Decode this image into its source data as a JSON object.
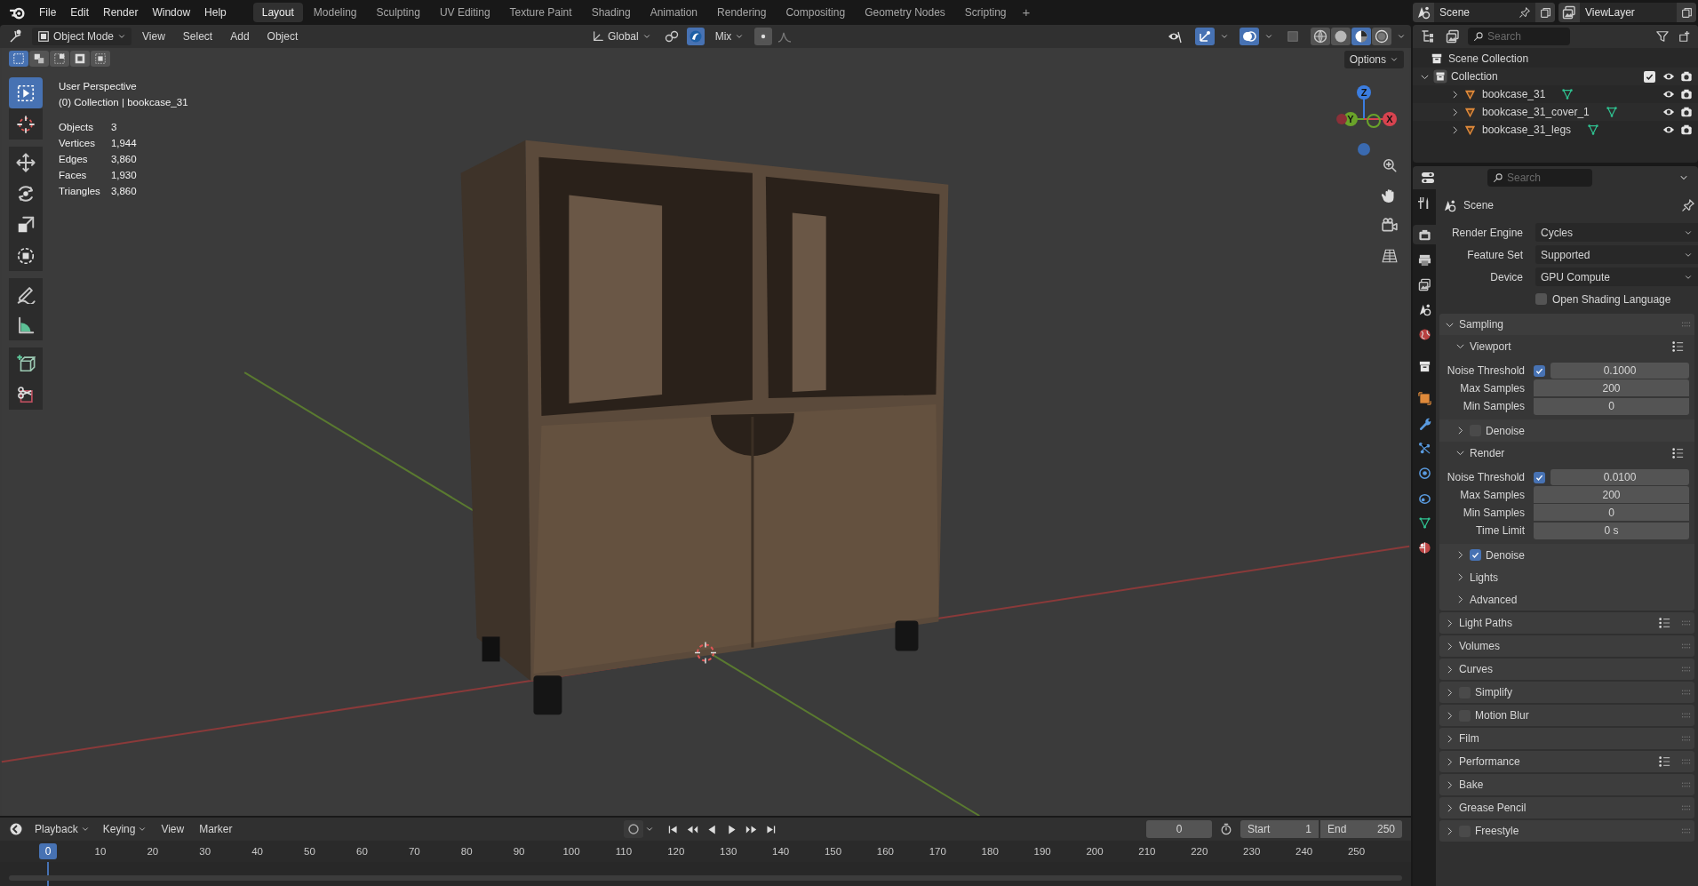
{
  "menu": [
    "File",
    "Edit",
    "Render",
    "Window",
    "Help"
  ],
  "workspaces": [
    {
      "label": "Layout",
      "selected": true
    },
    {
      "label": "Modeling",
      "selected": false
    },
    {
      "label": "Sculpting",
      "selected": false
    },
    {
      "label": "UV Editing",
      "selected": false
    },
    {
      "label": "Texture Paint",
      "selected": false
    },
    {
      "label": "Shading",
      "selected": false
    },
    {
      "label": "Animation",
      "selected": false
    },
    {
      "label": "Rendering",
      "selected": false
    },
    {
      "label": "Compositing",
      "selected": false
    },
    {
      "label": "Geometry Nodes",
      "selected": false
    },
    {
      "label": "Scripting",
      "selected": false
    }
  ],
  "add_workspace": "+",
  "scene": "Scene",
  "view_layer": "ViewLayer",
  "viewport_header": {
    "mode": "Object Mode",
    "menus": [
      "View",
      "Select",
      "Add",
      "Object"
    ],
    "orientation": "Global",
    "falloff": "Mix",
    "options": "Options",
    "shading": [
      {
        "kind": "wireframe",
        "selected": false
      },
      {
        "kind": "solid",
        "selected": false
      },
      {
        "kind": "material",
        "selected": true
      },
      {
        "kind": "rendered",
        "selected": false
      }
    ]
  },
  "overlay": {
    "title": "User Perspective",
    "context": "(0) Collection | bookcase_31",
    "stats": [
      {
        "label": "Objects",
        "value": "3"
      },
      {
        "label": "Vertices",
        "value": "1,944"
      },
      {
        "label": "Edges",
        "value": "3,860"
      },
      {
        "label": "Faces",
        "value": "1,930"
      },
      {
        "label": "Triangles",
        "value": "3,860"
      }
    ]
  },
  "gizmo_axes": [
    "Z",
    "Y",
    "X"
  ],
  "outliner": {
    "search_placeholder": "Search",
    "root": "Scene Collection",
    "collection": {
      "label": "Collection",
      "expanded": true,
      "checked": true,
      "children": [
        {
          "label": "bookcase_31",
          "expanded": false
        },
        {
          "label": "bookcase_31_cover_1",
          "expanded": false
        },
        {
          "label": "bookcase_31_legs",
          "expanded": false
        }
      ]
    }
  },
  "properties": {
    "search_placeholder": "Search",
    "title": "Scene",
    "tabs": [
      {
        "kind": "tool",
        "selected": false
      },
      {
        "kind": "render",
        "selected": true
      },
      {
        "kind": "output",
        "selected": false
      },
      {
        "kind": "view_layer",
        "selected": false
      },
      {
        "kind": "scene",
        "selected": false
      },
      {
        "kind": "world",
        "selected": false
      },
      {
        "kind": "collection",
        "selected": false
      },
      {
        "kind": "object",
        "selected": false
      },
      {
        "kind": "modifiers",
        "selected": false
      },
      {
        "kind": "particles",
        "selected": false
      },
      {
        "kind": "physics",
        "selected": false
      },
      {
        "kind": "constraints",
        "selected": false
      },
      {
        "kind": "data",
        "selected": false
      },
      {
        "kind": "material",
        "selected": false
      }
    ],
    "fields": [
      {
        "label": "Render Engine",
        "value": "Cycles"
      },
      {
        "label": "Feature Set",
        "value": "Supported"
      },
      {
        "label": "Device",
        "value": "GPU Compute"
      }
    ],
    "osl": {
      "label": "Open Shading Language",
      "checked": false
    },
    "panels": [
      {
        "label": "Sampling",
        "expanded": true,
        "children": [
          {
            "label": "Viewport",
            "expanded": true,
            "presets": true,
            "rows": [
              {
                "kind": "toggle_number",
                "label": "Noise Threshold",
                "checked": true,
                "value": "0.1000"
              },
              {
                "kind": "number",
                "label": "Max Samples",
                "value": "200"
              },
              {
                "kind": "number",
                "label": "Min Samples",
                "value": "0"
              }
            ]
          },
          {
            "label": "Denoise",
            "expanded": false,
            "checked": false
          },
          {
            "label": "Render",
            "expanded": true,
            "presets": true,
            "rows": [
              {
                "kind": "toggle_number",
                "label": "Noise Threshold",
                "checked": true,
                "value": "0.0100"
              },
              {
                "kind": "number",
                "label": "Max Samples",
                "value": "200"
              },
              {
                "kind": "number",
                "label": "Min Samples",
                "value": "0"
              },
              {
                "kind": "number",
                "label": "Time Limit",
                "value": "0 s"
              }
            ]
          },
          {
            "label": "Denoise",
            "expanded": false,
            "checked": true
          },
          {
            "label": "Lights",
            "expanded": false
          },
          {
            "label": "Advanced",
            "expanded": false
          }
        ]
      },
      {
        "label": "Light Paths",
        "expanded": false,
        "presets": true
      },
      {
        "label": "Volumes",
        "expanded": false
      },
      {
        "label": "Curves",
        "expanded": false
      },
      {
        "label": "Simplify",
        "expanded": false,
        "checked": false
      },
      {
        "label": "Motion Blur",
        "expanded": false,
        "checked": false
      },
      {
        "label": "Film",
        "expanded": false
      },
      {
        "label": "Performance",
        "expanded": false,
        "presets": true
      },
      {
        "label": "Bake",
        "expanded": false
      },
      {
        "label": "Grease Pencil",
        "expanded": false
      },
      {
        "label": "Freestyle",
        "expanded": false,
        "checked": false
      }
    ]
  },
  "timeline": {
    "menus": [
      "Playback",
      "Keying",
      "View",
      "Marker"
    ],
    "current_frame": "0",
    "start_label": "Start",
    "start": "1",
    "end_label": "End",
    "end": "250",
    "playhead": "0",
    "ticks": [
      "10",
      "20",
      "30",
      "40",
      "50",
      "60",
      "70",
      "80",
      "90",
      "100",
      "110",
      "120",
      "130",
      "140",
      "150",
      "160",
      "170",
      "180",
      "190",
      "200",
      "210",
      "220",
      "230",
      "240",
      "250"
    ]
  }
}
